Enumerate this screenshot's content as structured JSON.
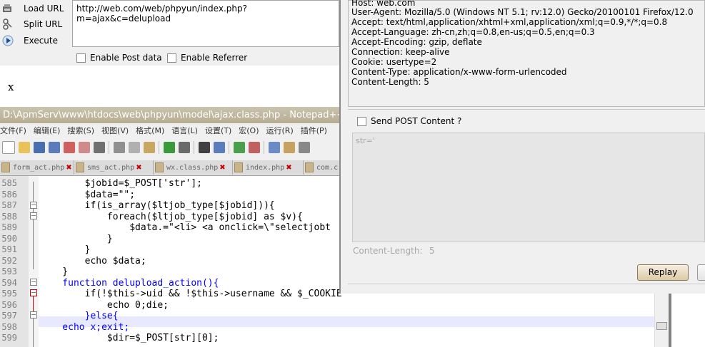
{
  "hackbar": {
    "items": [
      {
        "label": "Load URL",
        "icon": "load-url-icon"
      },
      {
        "label": "Split URL",
        "icon": "split-url-icon"
      },
      {
        "label": "Execute",
        "icon": "execute-icon"
      }
    ],
    "url": "http://web.com/web/phpyun/index.php?m=ajax&c=delupload",
    "enable_post": "Enable Post data",
    "enable_referrer": "Enable Referrer"
  },
  "page_output": "x",
  "notepad": {
    "title": "D:\\ApmServ\\www\\htdocs\\web\\phpyun\\model\\ajax.class.php - Notepad++",
    "menu": [
      "文件(F)",
      "编辑(E)",
      "搜索(S)",
      "视图(V)",
      "格式(M)",
      "语言(L)",
      "设置(T)",
      "宏(O)",
      "运行(R)",
      "插件(P)"
    ],
    "tabs": [
      "form_act.php",
      "sms_act.php",
      "wx.class.php",
      "index.php",
      "com.c"
    ],
    "lines": [
      {
        "n": "585",
        "text": "        $jobid=$_POST['str'];"
      },
      {
        "n": "586",
        "text": "        $data=\"\";"
      },
      {
        "n": "587",
        "text": "        if(is_array($ltjob_type[$jobid])){"
      },
      {
        "n": "588",
        "text": "            foreach($ltjob_type[$jobid] as $v){"
      },
      {
        "n": "589",
        "text": "                $data.=\"<li> <a onclick=\\\"selectjobt"
      },
      {
        "n": "590",
        "text": "            }"
      },
      {
        "n": "591",
        "text": "        }"
      },
      {
        "n": "592",
        "text": "        echo $data;"
      },
      {
        "n": "593",
        "text": "    }"
      },
      {
        "n": "594",
        "text": "    function delupload_action(){"
      },
      {
        "n": "595",
        "text": "        if(!$this->uid && !$this->username && $_COOKIE"
      },
      {
        "n": "596",
        "text": "            echo 0;die;"
      },
      {
        "n": "597",
        "text": "        }else{"
      },
      {
        "n": "598",
        "text": "    echo x;exit;"
      },
      {
        "n": "599",
        "text": "            $dir=$_POST[str][0];"
      }
    ]
  },
  "replay_panel": {
    "headers": [
      "Host: web.com",
      "User-Agent: Mozilla/5.0 (Windows NT 5.1; rv:12.0) Gecko/20100101 Firefox/12.0",
      "Accept: text/html,application/xhtml+xml,application/xml;q=0.9,*/*;q=0.8",
      "Accept-Language: zh-cn,zh;q=0.8,en-us;q=0.5,en;q=0.3",
      "Accept-Encoding: gzip, deflate",
      "Connection: keep-alive",
      "Cookie: usertype=2",
      "Content-Type: application/x-www-form-urlencoded",
      "Content-Length: 5"
    ],
    "send_post": "Send POST Content ?",
    "post_content": "str='",
    "content_length_label": "Content-Length:",
    "content_length_value": "5",
    "replay_label": "Replay"
  }
}
